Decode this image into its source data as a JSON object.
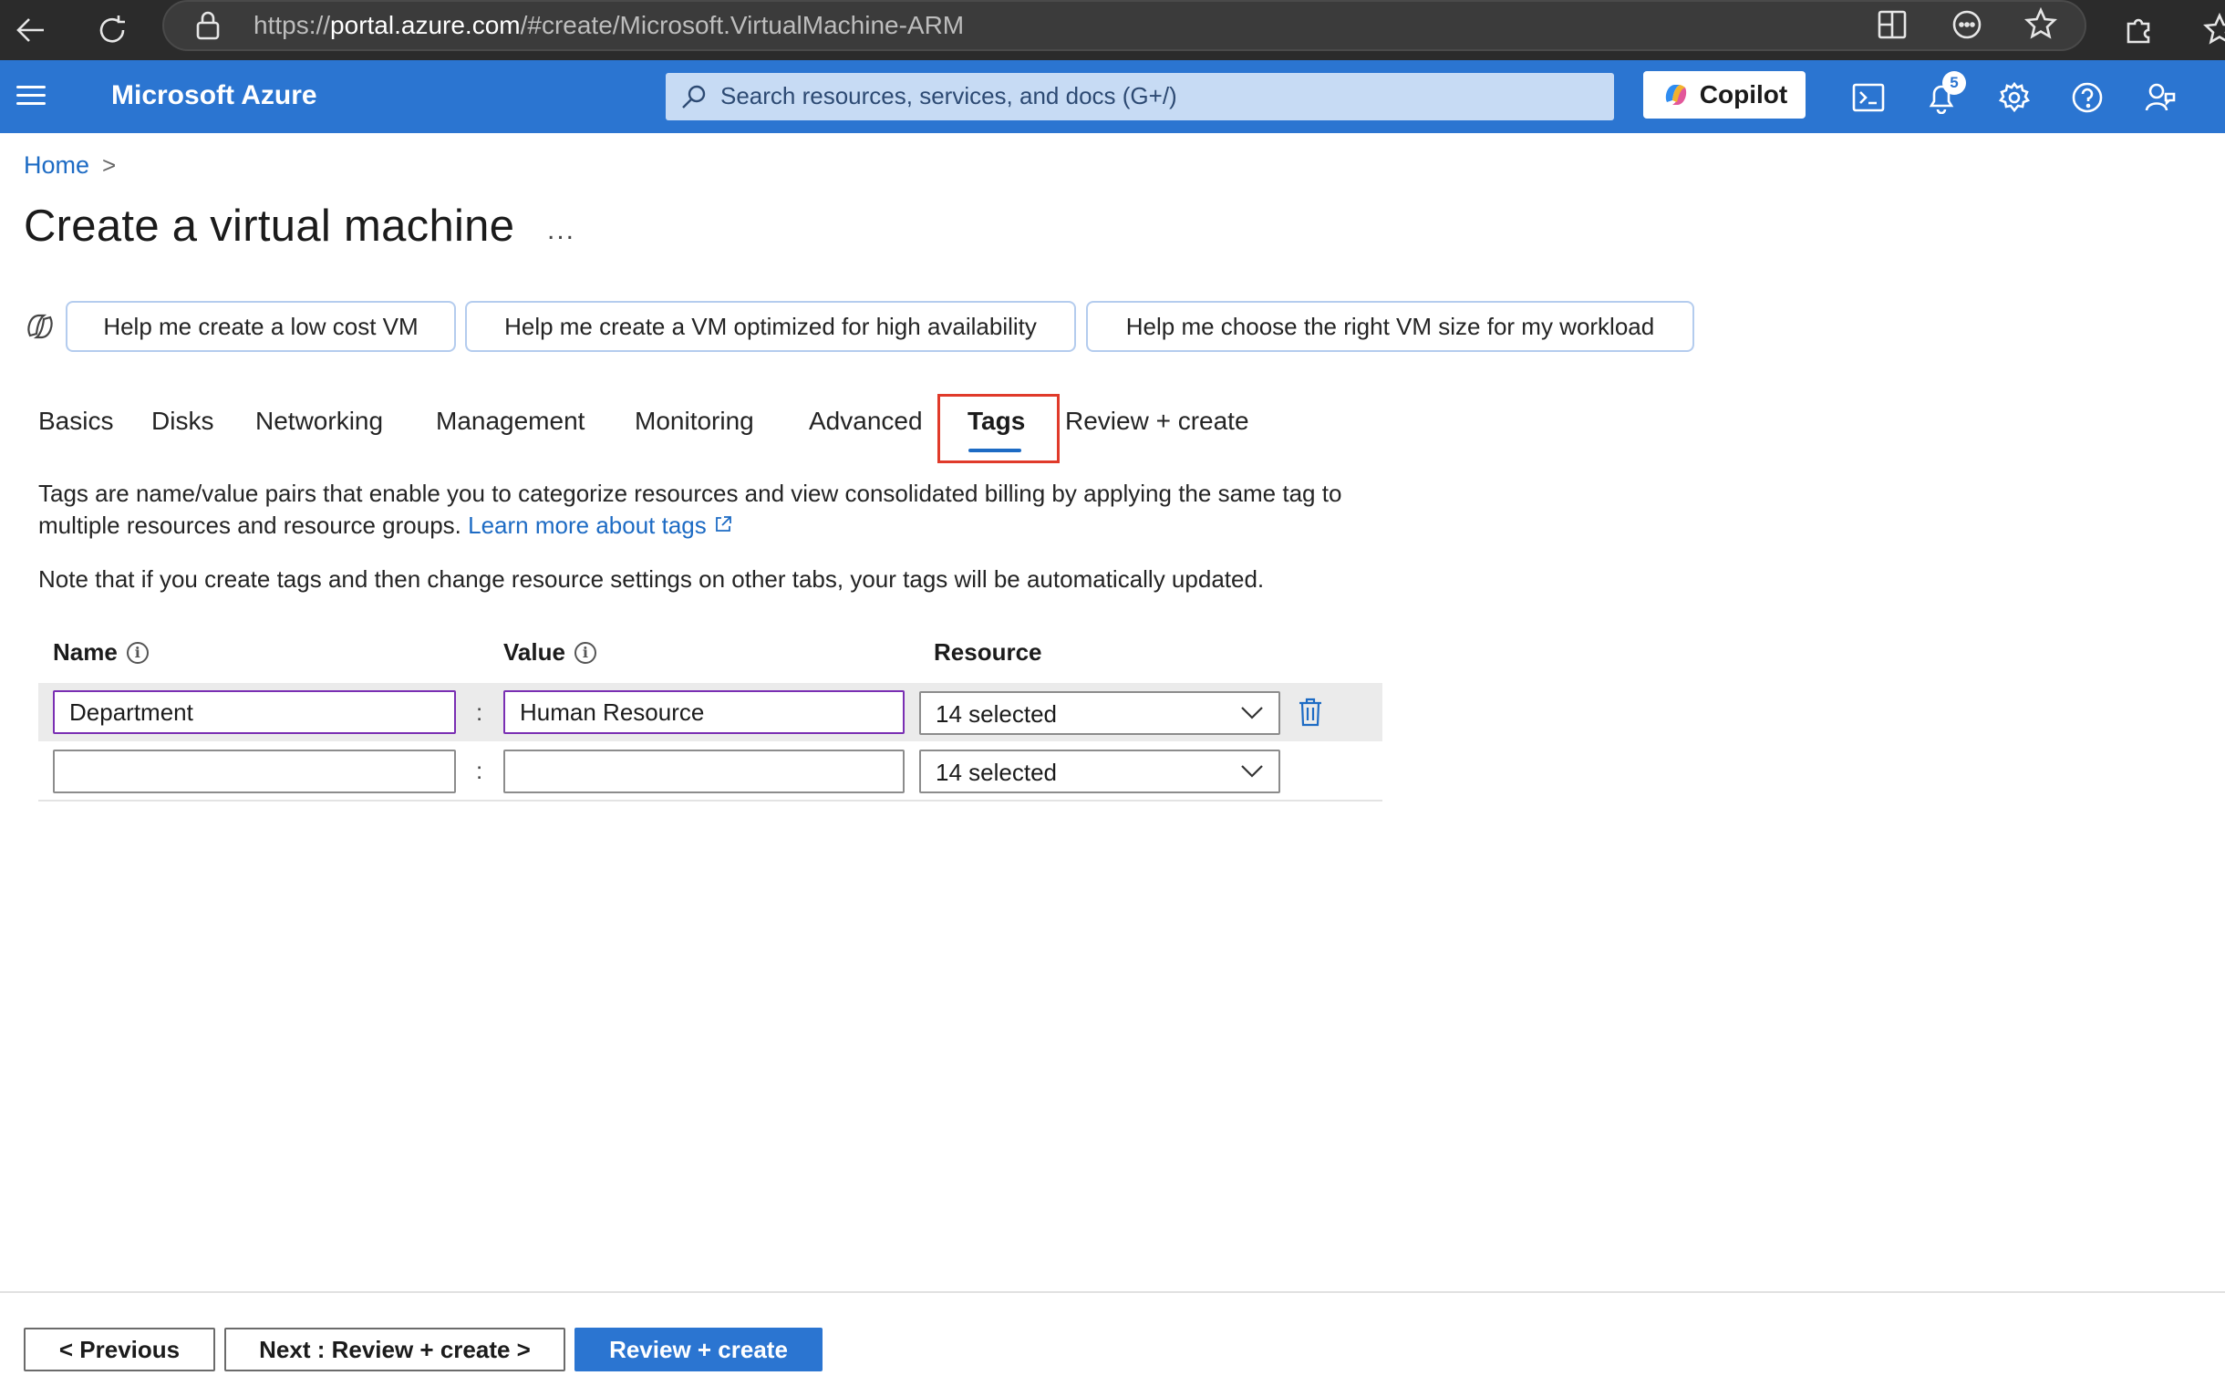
{
  "browser": {
    "url_scheme": "https://",
    "url_host": "portal.azure.com",
    "url_path": "/#create/Microsoft.VirtualMachine-ARM"
  },
  "header": {
    "brand": "Microsoft Azure",
    "search_placeholder": "Search resources, services, and docs (G+/)",
    "copilot_label": "Copilot",
    "notification_count": "5",
    "accent_color": "#2b75d1"
  },
  "breadcrumb": {
    "home": "Home",
    "separator": ">"
  },
  "page": {
    "title": "Create a virtual machine",
    "more": "..."
  },
  "suggestions": [
    "Help me create a low cost VM",
    "Help me create a VM optimized for high availability",
    "Help me choose the right VM size for my workload"
  ],
  "tabs": [
    {
      "label": "Basics",
      "active": false
    },
    {
      "label": "Disks",
      "active": false
    },
    {
      "label": "Networking",
      "active": false
    },
    {
      "label": "Management",
      "active": false
    },
    {
      "label": "Monitoring",
      "active": false
    },
    {
      "label": "Advanced",
      "active": false
    },
    {
      "label": "Tags",
      "active": true
    },
    {
      "label": "Review + create",
      "active": false
    }
  ],
  "content": {
    "description": "Tags are name/value pairs that enable you to categorize resources and view consolidated billing by applying the same tag to multiple resources and resource groups.",
    "learn_more": "Learn more about tags",
    "note": "Note that if you create tags and then change resource settings on other tabs, your tags will be automatically updated."
  },
  "table": {
    "headers": {
      "name": "Name",
      "value": "Value",
      "resource": "Resource"
    },
    "rows": [
      {
        "name": "Department",
        "value": "Human Resource",
        "resource": "14 selected"
      },
      {
        "name": "",
        "value": "",
        "resource": "14 selected"
      }
    ],
    "colon": ":"
  },
  "footer": {
    "previous": "< Previous",
    "next": "Next : Review + create >",
    "review_create": "Review + create"
  }
}
